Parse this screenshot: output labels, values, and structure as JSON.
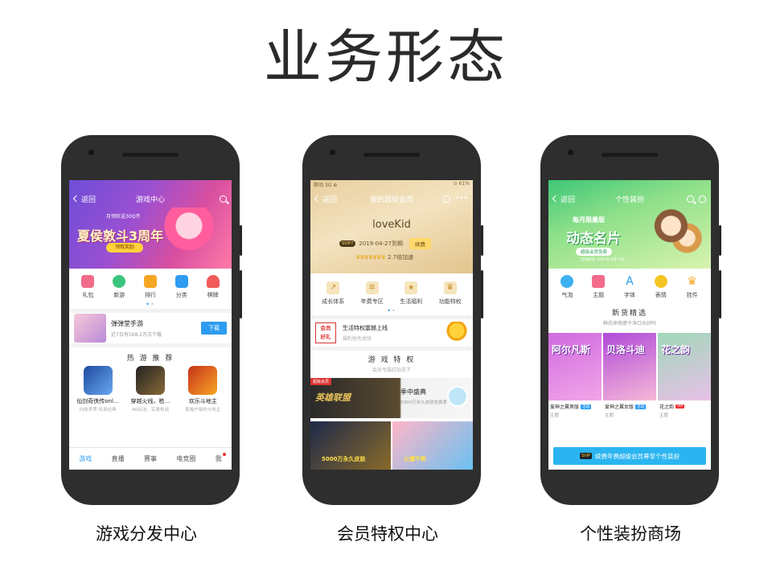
{
  "page": {
    "title": "业务形态"
  },
  "captions": [
    "游戏分发中心",
    "会员特权中心",
    "个性装扮商场"
  ],
  "status": {
    "left": "移动 3G ⊕",
    "right": "⊙ 61%"
  },
  "phone1": {
    "nav": {
      "back": "返回",
      "title": "游戏中心"
    },
    "banner": {
      "main": "夏侯敦斗3周年",
      "sub": "月领狂送30Q币",
      "button": "领取奖励"
    },
    "icons": [
      {
        "label": "礼包",
        "color": "#f26b8a"
      },
      {
        "label": "新游",
        "color": "#3cc47c"
      },
      {
        "label": "排行",
        "color": "#f5a623"
      },
      {
        "label": "分类",
        "color": "#2d9cf0"
      },
      {
        "label": "棋牌",
        "color": "#f25a5a"
      }
    ],
    "promo": {
      "title": "弹弹堂手游",
      "desc": "近7日有168.2万次下载",
      "button": "下载"
    },
    "section": "热 游 推 荐",
    "games": [
      {
        "name": "仙剑奇侠传onl…",
        "desc": "仙侠世界 传承经典",
        "color": "#3a7fd0"
      },
      {
        "name": "穿越火线，枪…",
        "desc": "AR玩法，实景枪战",
        "color": "#4a4a4a"
      },
      {
        "name": "欢乐斗地主",
        "desc": "家喻户晓的斗地主",
        "color": "#e8442a"
      }
    ],
    "tabs": [
      "游戏",
      "直播",
      "赛事",
      "电竞圈",
      "我"
    ]
  },
  "phone2": {
    "nav": {
      "back": "返回",
      "title": "我的超级会员"
    },
    "name": "loveKid",
    "badge": "SVIP7",
    "expire": "2019-04-27到期",
    "renew": "续费",
    "speed": "2.7倍加速",
    "icons": [
      {
        "label": "成长体系",
        "glyph": "↗"
      },
      {
        "label": "年费专区",
        "glyph": "年"
      },
      {
        "label": "生活福利",
        "glyph": "★"
      },
      {
        "label": "功能特权",
        "glyph": "♛"
      }
    ],
    "promo": {
      "logo_line1": "会员",
      "logo_line2": "好礼",
      "title": "生活特权震撼上线",
      "desc": "福利抢先体验"
    },
    "section": {
      "title": "游 戏 特 权",
      "sub": "会员专属红钻天下"
    },
    "banner": {
      "ribbon": "超级会员",
      "logo": "英雄联盟",
      "title": "季中盛典",
      "desc": "5000万永久皮肤免费拿"
    },
    "thumbs": [
      "5000万永久皮肤",
      "火爆不断"
    ]
  },
  "phone3": {
    "nav": {
      "back": "返回",
      "title": "个性装扮"
    },
    "banner": {
      "top": "每月限量版",
      "main": "动态名片",
      "button": "超级会员免费",
      "sub": "活动时间: 6月1日-6月13日"
    },
    "icons": [
      {
        "label": "气泡",
        "color": "#3cb0f0"
      },
      {
        "label": "主题",
        "color": "#f26b8a"
      },
      {
        "label": "字体",
        "color": "#2d9cf0"
      },
      {
        "label": "表情",
        "color": "#f5c623"
      },
      {
        "label": "挂件",
        "color": "#f5a623"
      }
    ],
    "section": {
      "title": "新货精选",
      "sub": "鲜肉来咯擦干净口水好吗"
    },
    "tiles": [
      {
        "art": "阿尔凡斯",
        "name": "爱神之翼男版",
        "tag": "活动",
        "tag_color": "#2d9cf0",
        "kind": "主题",
        "bg": "linear-gradient(160deg,#d06ae0,#f2a6e8)"
      },
      {
        "art": "贝洛斗迪",
        "name": "爱神之翼女版",
        "tag": "活动",
        "tag_color": "#2d9cf0",
        "kind": "主题",
        "bg": "linear-gradient(160deg,#b04ad8,#f6b8d8)"
      },
      {
        "art": "花之韵",
        "name": "花之韵",
        "tag": "VIP",
        "tag_color": "#e33",
        "kind": "主题",
        "bg": "linear-gradient(160deg,#9fd8b8,#e8c0e8)"
      }
    ],
    "cta": {
      "badge": "SVIP",
      "text": "续费年费超级会员尊享个性装扮"
    }
  }
}
